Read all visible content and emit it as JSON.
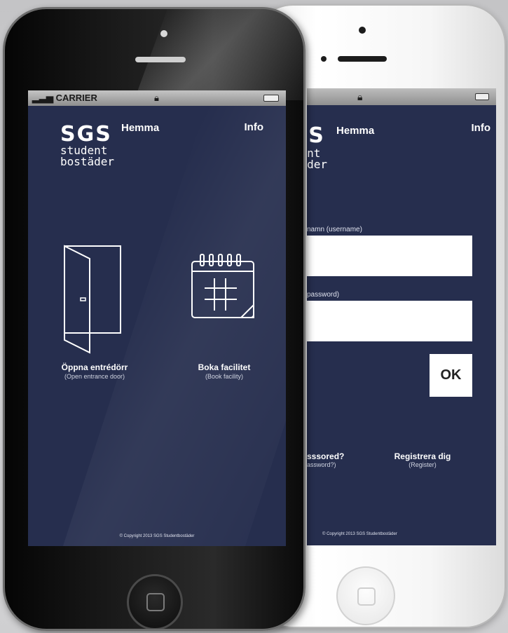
{
  "colors": {
    "screen_bg": "#262e4e",
    "text": "#ffffff",
    "statusbar": "#a8a8a8"
  },
  "status_bar": {
    "carrier": "CARRIER",
    "lock_icon": "lock-icon",
    "battery_icon": "battery-icon"
  },
  "logo": {
    "brand": "SGS",
    "line1": "student",
    "line2": "bostäder"
  },
  "home_screen": {
    "hemma": "Hemma",
    "info": "Info",
    "tiles": [
      {
        "icon": "door-icon",
        "label": "Öppna entrédörr",
        "sub": "(Open entrance door)"
      },
      {
        "icon": "calendar-icon",
        "label": "Boka facilitet",
        "sub": "(Book facility)"
      }
    ],
    "copyright": "© Copyright 2013 SGS Studentbostäder"
  },
  "login_screen": {
    "hemma": "Hemma",
    "info": "Info",
    "logo_partial_line1": "nt",
    "logo_partial_line2": "der",
    "username_label": "namn (username)",
    "password_label": "password)",
    "ok_button": "OK",
    "forgot": "sssored?",
    "forgot_sub": "assword?)",
    "register": "Registrera dig",
    "register_sub": "(Register)",
    "copyright": "© Copyright 2013 SGS Studentbostäder"
  }
}
